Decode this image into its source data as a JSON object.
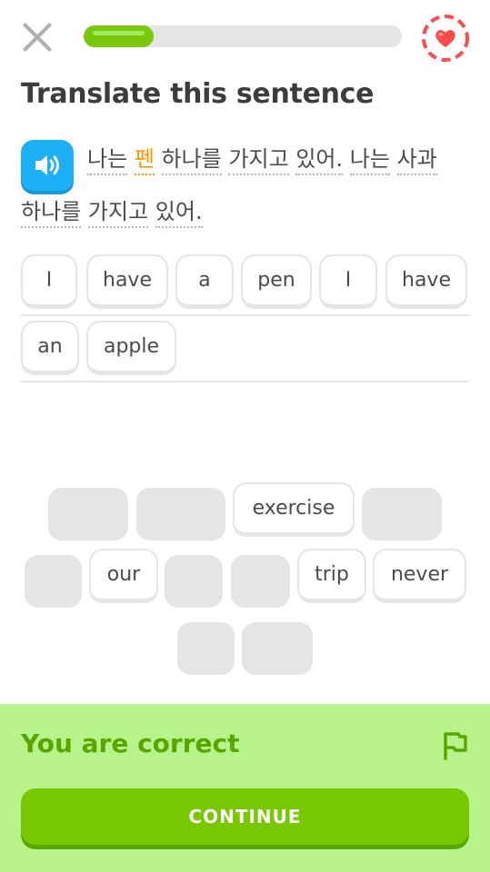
{
  "header": {
    "close_icon": "close-icon",
    "progress": 0.22,
    "hearts_icon": "heart-icon",
    "colors": {
      "progress": "#7ac70c",
      "hearts": "#ff4b4b"
    }
  },
  "title": "Translate this sentence",
  "prompt": {
    "words_line1": [
      "나는",
      "펜",
      "하나를",
      "가지고",
      "있어.",
      "나는",
      "사과"
    ],
    "words_line2": [
      "하나를",
      "가지고",
      "있어."
    ],
    "highlighted_word": "펜",
    "speaker_icon": "speaker-icon"
  },
  "answer_tiles": [
    "I",
    "have",
    "a",
    "pen",
    "I",
    "have",
    "an",
    "apple"
  ],
  "word_bank": {
    "visible": [
      "exercise",
      "our",
      "trip",
      "never"
    ]
  },
  "feedback": {
    "message": "You are correct",
    "button_label": "CONTINUE",
    "flag_icon": "flag-icon",
    "colors": {
      "background": "#b8f28b",
      "text": "#58a700",
      "button": "#78c800"
    }
  }
}
